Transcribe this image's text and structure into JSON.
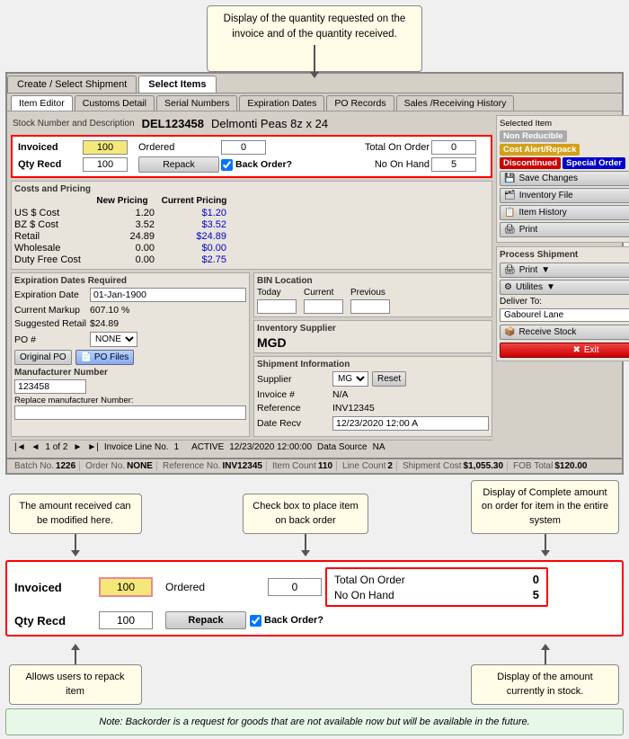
{
  "top_callout": {
    "text": "Display of the quantity requested on the invoice and of the quantity received."
  },
  "tabs": {
    "main": [
      "Create / Select Shipment",
      "Select Items"
    ],
    "sub": [
      "Item Editor",
      "Customs Detail",
      "Serial Numbers",
      "Expiration Dates",
      "PO Records",
      "Sales /Receiving History"
    ]
  },
  "stock": {
    "label": "Stock Number and Description",
    "number": "DEL123458",
    "description": "Delmonti Peas 8z x 24"
  },
  "inv": {
    "invoiced_label": "Invoiced",
    "qty_recd_label": "Qty Recd",
    "invoiced_val": "100",
    "qty_recd_val": "100",
    "ordered_label": "Ordered",
    "ordered_val": "0",
    "total_on_order_label": "Total On Order",
    "total_on_order_val": "0",
    "no_on_hand_label": "No On Hand",
    "no_on_hand_val": "5",
    "repack_label": "Repack",
    "back_order_label": "Back Order?"
  },
  "costs": {
    "header": "Costs and Pricing",
    "col1": "",
    "col2": "New Pricing",
    "col3": "Current Pricing",
    "rows": [
      {
        "label": "US $ Cost",
        "new": "1.20",
        "current": "$1.20"
      },
      {
        "label": "BZ $ Cost",
        "new": "3.52",
        "current": "$3.52"
      },
      {
        "label": "Retail",
        "new": "24.89",
        "current": "$24.89"
      },
      {
        "label": "Wholesale",
        "new": "0.00",
        "current": "$0.00"
      },
      {
        "label": "Duty Free Cost",
        "new": "0.00",
        "current": "$2.75"
      }
    ]
  },
  "expiration": {
    "header": "Expiration Dates Required",
    "exp_date_label": "Expiration Date",
    "exp_date_val": "01-Jan-1900",
    "current_markup_label": "Current Markup",
    "current_markup_val": "607.10 %",
    "suggested_retail_label": "Suggested Retail",
    "suggested_retail_val": "$24.89",
    "po_label": "PO #",
    "po_val": "NONE",
    "orig_po_btn": "Original PO",
    "po_files_btn": "PO Files",
    "mfr_number_label": "Manufacturer Number",
    "mfr_number_val": "123458",
    "replace_mfr_label": "Replace manufacturer Number:"
  },
  "bin": {
    "header": "BIN Location",
    "today_label": "Today",
    "current_label": "Current",
    "previous_label": "Previous",
    "today_val": "",
    "current_val": "",
    "previous_val": ""
  },
  "supplier": {
    "header": "Inventory Supplier",
    "val": "MGD"
  },
  "shipment": {
    "header": "Shipment Information",
    "supplier_label": "Supplier",
    "supplier_val": "MGD",
    "invoice_label": "Invoice #",
    "invoice_val": "N/A",
    "reference_label": "Reference",
    "reference_val": "INV12345",
    "date_recd_label": "Date Recv",
    "date_recd_val": "12/23/2020 12:00 A",
    "reset_btn": "Reset"
  },
  "bottom_bar": {
    "active_label": "ACTIVE",
    "date_val": "12/23/2020 12:00:00",
    "data_source_label": "Data Source",
    "data_source_val": "NA",
    "invoice_line_label": "Invoice Line No.",
    "invoice_line_val": "1",
    "pagination": "1 of 2"
  },
  "status_bar": {
    "batch_label": "Batch No.",
    "batch_val": "1226",
    "order_label": "Order No.",
    "order_val": "NONE",
    "ref_label": "Reference No.",
    "ref_val": "INV12345",
    "item_count_label": "Item Count",
    "item_count_val": "110",
    "line_count_label": "Line Count",
    "line_count_val": "2",
    "ship_cost_label": "Shipment Cost",
    "ship_cost_val": "$1,055.30",
    "fob_total_label": "FOB Total",
    "fob_total_val": "$120.00"
  },
  "right_panel": {
    "selected_item_label": "Selected Item",
    "badges": [
      "Non Reducible",
      "Cost Alert/Repack",
      "Discontinued",
      "Special Order"
    ],
    "save_btn": "Save Changes",
    "inv_file_btn": "Inventory File",
    "item_hist_btn": "Item History",
    "print_btn": "Print",
    "process_label": "Process Shipment",
    "print2_btn": "Print",
    "utilities_btn": "Utilites",
    "deliver_to_label": "Deliver To:",
    "deliver_to_val": "Gabourel Lane",
    "receive_stock_btn": "Receive Stock",
    "exit_btn": "Exit"
  },
  "diagram": {
    "callout_left": "The amount received can be modified here.",
    "callout_center": "Check box to place item on back order",
    "callout_right": "Display of Complete amount on order for item in the entire system",
    "callout_bottom_left": "Allows users to repack item",
    "callout_bottom_right": "Display of the amount currently in stock.",
    "note": "Note: Backorder is a request for goods that are not available now but will be available in the future."
  },
  "zoom": {
    "invoiced_label": "Invoiced",
    "qty_recd_label": "Qty Recd",
    "invoiced_val": "100",
    "qty_recd_val": "100",
    "ordered_label": "Ordered",
    "ordered_val": "0",
    "total_on_order_label": "Total On Order",
    "total_on_order_val": "0",
    "no_on_hand_label": "No On Hand",
    "no_on_hand_val": "5",
    "repack_btn": "Repack",
    "back_order_label": "Back Order?"
  }
}
